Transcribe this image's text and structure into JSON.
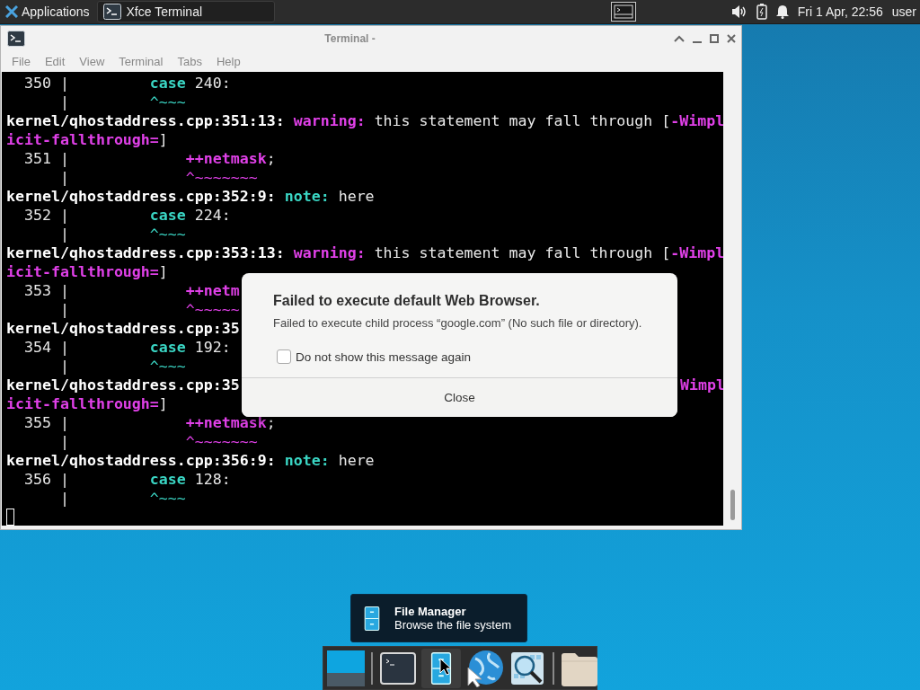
{
  "top_panel": {
    "apps_menu": "Applications",
    "tasks": [
      {
        "label": "Xfce Terminal",
        "selected": true
      }
    ],
    "clock": "Fri 1 Apr, 22:56",
    "user": "user"
  },
  "terminal": {
    "title": "Terminal -",
    "menu": [
      "File",
      "Edit",
      "View",
      "Terminal",
      "Tabs",
      "Help"
    ],
    "lines": [
      {
        "parts": [
          {
            "kind": "plain",
            "text": "  350 |         "
          },
          {
            "kind": "cyan-bold",
            "text": "case"
          },
          {
            "kind": "plain",
            "text": " 240:"
          }
        ]
      },
      {
        "parts": [
          {
            "kind": "plain",
            "text": "      |         "
          },
          {
            "kind": "cyan",
            "text": "^~~~"
          }
        ]
      },
      {
        "parts": [
          {
            "kind": "bold",
            "text": "kernel/qhostaddress.cpp:351:13: "
          },
          {
            "kind": "magenta-bold",
            "text": "warning:"
          },
          {
            "kind": "plain",
            "text": " this statement may fall through ["
          },
          {
            "kind": "magenta-bold",
            "text": "-Wimpl"
          }
        ]
      },
      {
        "parts": [
          {
            "kind": "magenta-bold",
            "text": "icit-fallthrough="
          },
          {
            "kind": "plain",
            "text": "]"
          }
        ]
      },
      {
        "parts": [
          {
            "kind": "plain",
            "text": "  351 |             "
          },
          {
            "kind": "magenta-bold",
            "text": "++netmask"
          },
          {
            "kind": "plain",
            "text": ";"
          }
        ]
      },
      {
        "parts": [
          {
            "kind": "plain",
            "text": "      |             "
          },
          {
            "kind": "magenta",
            "text": "^~~~~~~~"
          }
        ]
      },
      {
        "parts": [
          {
            "kind": "bold",
            "text": "kernel/qhostaddress.cpp:352:9: "
          },
          {
            "kind": "cyan-bold",
            "text": "note:"
          },
          {
            "kind": "plain",
            "text": " here"
          }
        ]
      },
      {
        "parts": [
          {
            "kind": "plain",
            "text": "  352 |         "
          },
          {
            "kind": "cyan-bold",
            "text": "case"
          },
          {
            "kind": "plain",
            "text": " 224:"
          }
        ]
      },
      {
        "parts": [
          {
            "kind": "plain",
            "text": "      |         "
          },
          {
            "kind": "cyan",
            "text": "^~~~"
          }
        ]
      },
      {
        "parts": [
          {
            "kind": "bold",
            "text": "kernel/qhostaddress.cpp:353:13: "
          },
          {
            "kind": "magenta-bold",
            "text": "warning:"
          },
          {
            "kind": "plain",
            "text": " this statement may fall through ["
          },
          {
            "kind": "magenta-bold",
            "text": "-Wimpl"
          }
        ]
      },
      {
        "parts": [
          {
            "kind": "magenta-bold",
            "text": "icit-fallthrough="
          },
          {
            "kind": "plain",
            "text": "]"
          }
        ]
      },
      {
        "parts": [
          {
            "kind": "plain",
            "text": "  353 |             "
          },
          {
            "kind": "magenta-bold",
            "text": "++netm"
          }
        ]
      },
      {
        "parts": [
          {
            "kind": "plain",
            "text": "      |             "
          },
          {
            "kind": "magenta",
            "text": "^~~~~~"
          }
        ]
      },
      {
        "parts": [
          {
            "kind": "bold",
            "text": "kernel/qhostaddress.cpp:35"
          }
        ]
      },
      {
        "parts": [
          {
            "kind": "plain",
            "text": "  354 |         "
          },
          {
            "kind": "cyan-bold",
            "text": "case"
          },
          {
            "kind": "plain",
            "text": " 192:"
          }
        ]
      },
      {
        "parts": [
          {
            "kind": "plain",
            "text": "      |         "
          },
          {
            "kind": "cyan",
            "text": "^~~~"
          }
        ]
      },
      {
        "parts": [
          {
            "kind": "bold",
            "text": "kernel/qhostaddress.cpp:35"
          }
        ],
        "tail": [
          {
            "kind": "magenta-bold",
            "text": "Wimpl"
          }
        ]
      },
      {
        "parts": [
          {
            "kind": "magenta-bold",
            "text": "icit-fallthrough="
          },
          {
            "kind": "plain",
            "text": "]"
          }
        ]
      },
      {
        "parts": [
          {
            "kind": "plain",
            "text": "  355 |             "
          },
          {
            "kind": "magenta-bold",
            "text": "++netmask"
          },
          {
            "kind": "plain",
            "text": ";"
          }
        ]
      },
      {
        "parts": [
          {
            "kind": "plain",
            "text": "      |             "
          },
          {
            "kind": "magenta",
            "text": "^~~~~~~~"
          }
        ]
      },
      {
        "parts": [
          {
            "kind": "bold",
            "text": "kernel/qhostaddress.cpp:356:9: "
          },
          {
            "kind": "cyan-bold",
            "text": "note:"
          },
          {
            "kind": "plain",
            "text": " here"
          }
        ]
      },
      {
        "parts": [
          {
            "kind": "plain",
            "text": "  356 |         "
          },
          {
            "kind": "cyan-bold",
            "text": "case"
          },
          {
            "kind": "plain",
            "text": " 128:"
          }
        ]
      },
      {
        "parts": [
          {
            "kind": "plain",
            "text": "      |         "
          },
          {
            "kind": "cyan",
            "text": "^~~~"
          }
        ]
      }
    ]
  },
  "dialog": {
    "title": "Failed to execute default Web Browser.",
    "message": "Failed to execute child process “google.com” (No such file or directory).",
    "checkbox": {
      "label": "Do not show this message again",
      "checked": false
    },
    "button": "Close"
  },
  "tooltip": {
    "title": "File Manager",
    "subtitle": "Browse the file system"
  },
  "dock": [
    {
      "kind": "desktop",
      "selected": false
    },
    {
      "kind": "separator"
    },
    {
      "kind": "terminal",
      "selected": false
    },
    {
      "kind": "files",
      "selected": true
    },
    {
      "kind": "browser",
      "selected": false
    },
    {
      "kind": "search",
      "selected": false
    },
    {
      "kind": "separator"
    },
    {
      "kind": "folder",
      "selected": false
    }
  ]
}
